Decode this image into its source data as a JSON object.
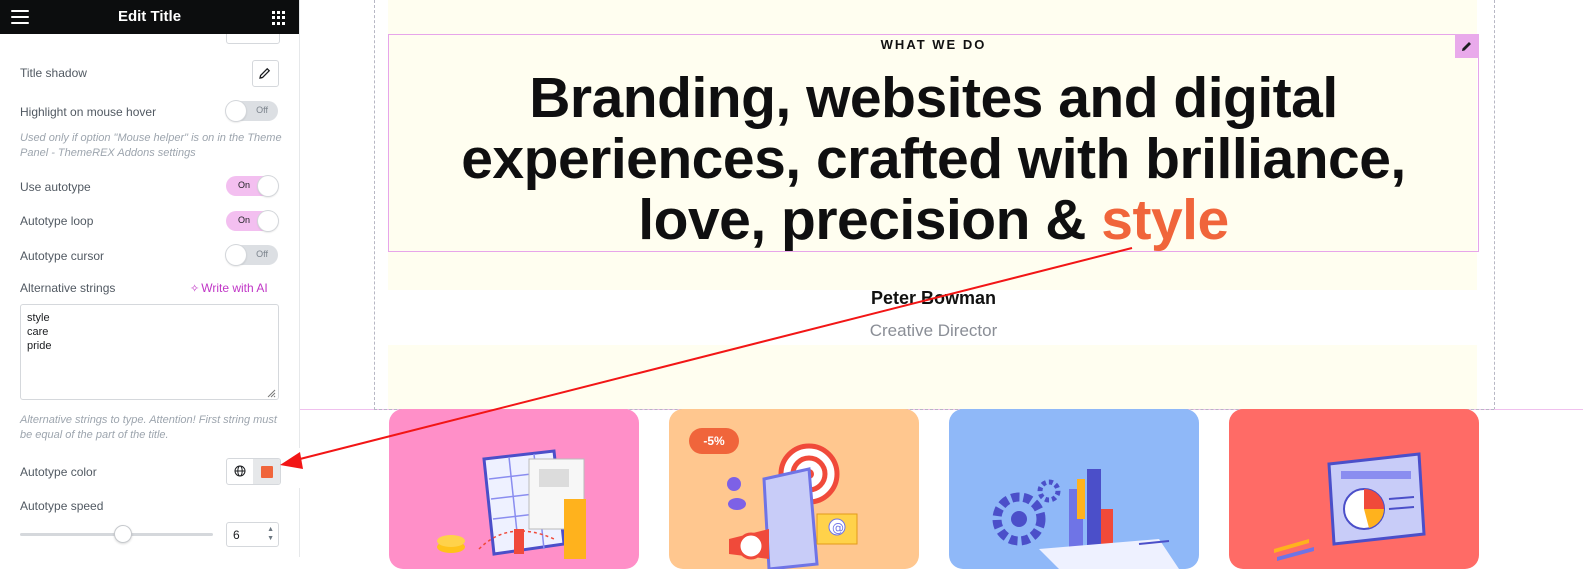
{
  "panel": {
    "title": "Edit Title",
    "controls": {
      "title_shadow": "Title shadow",
      "highlight_hover": "Highlight on mouse hover",
      "highlight_hint": "Used only if option \"Mouse helper\" is on in the Theme Panel - ThemeREX Addons settings",
      "use_autotype": "Use autotype",
      "autotype_loop": "Autotype loop",
      "autotype_cursor": "Autotype cursor",
      "alternative_strings": "Alternative strings",
      "write_with_ai": "Write with AI",
      "alt_strings_value": "style\ncare\npride",
      "alt_strings_hint": "Alternative strings to type. Attention! First string must be equal of the part of the title.",
      "autotype_color": "Autotype color",
      "autotype_color_value": "#f0653b",
      "autotype_speed": "Autotype speed",
      "autotype_speed_value": "6",
      "autotype_speed_percent": 53
    },
    "switches": {
      "highlight_hover": "Off",
      "use_autotype": "On",
      "autotype_loop": "On",
      "autotype_cursor": "Off"
    }
  },
  "canvas": {
    "eyebrow": "WHAT WE DO",
    "headline_line1": "Branding, websites and digital",
    "headline_line2": "experiences, crafted with brilliance,",
    "headline_line3_prefix": "love, precision & ",
    "headline_highlight": "style",
    "author_name": "Peter Bowman",
    "author_role": "Creative Director",
    "discount_badge": "-5%",
    "colors": {
      "accent": "#f0653b",
      "card_pink": "#ff8fc8",
      "card_peach": "#ffc78f",
      "card_blue": "#8fb8f8",
      "card_red": "#ff6b66"
    }
  }
}
